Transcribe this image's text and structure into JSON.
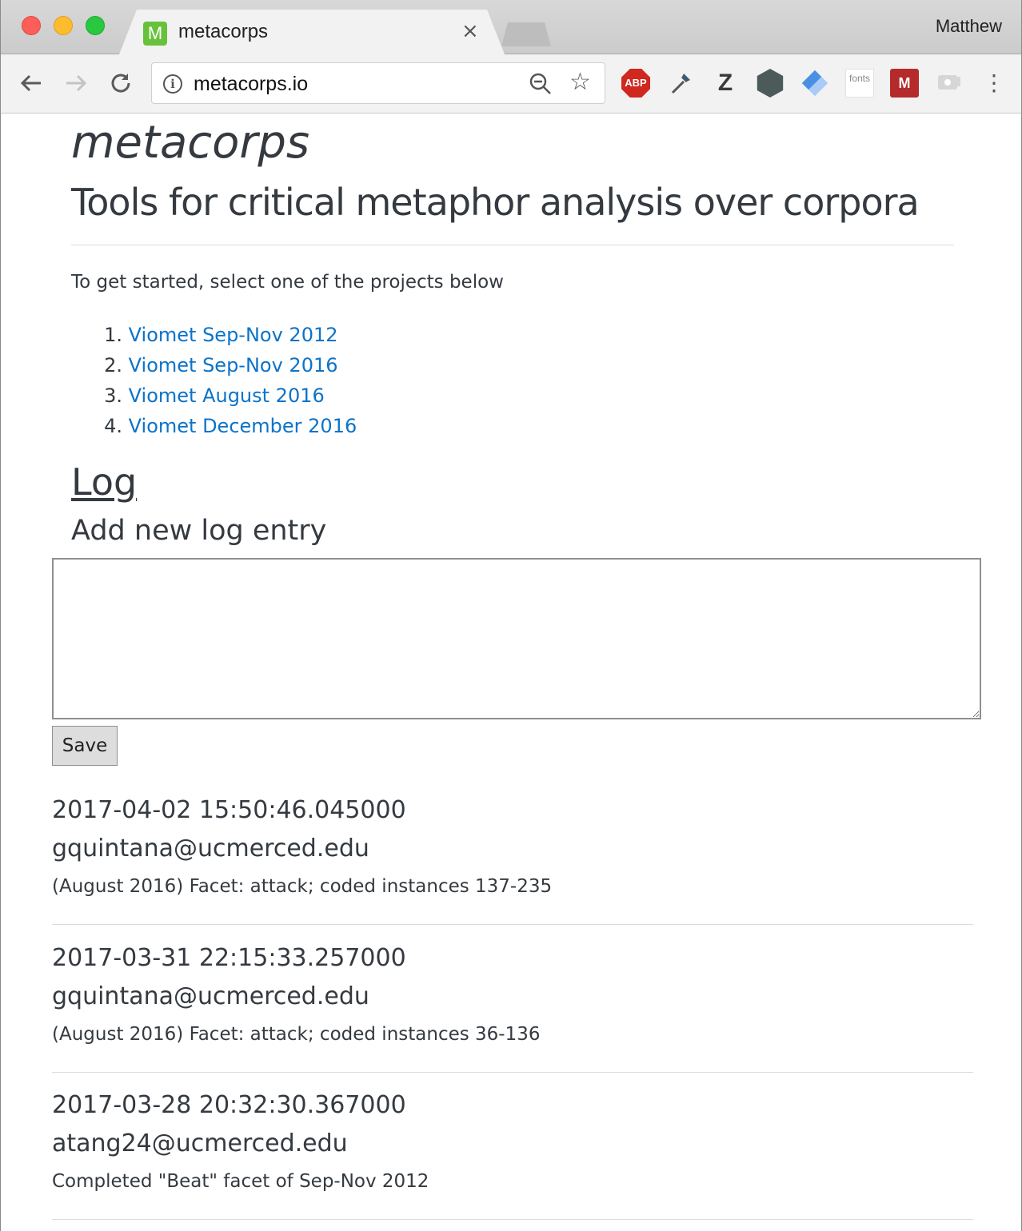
{
  "browser": {
    "profile_name": "Matthew",
    "tab": {
      "favicon_letter": "M",
      "title": "metacorps",
      "close_glyph": "×"
    },
    "url": "metacorps.io",
    "extensions": {
      "abp_label": "ABP",
      "z_label": "Z",
      "fonts_label": "fonts",
      "mendeley_label": "M"
    },
    "menu_glyph": "⋮"
  },
  "page": {
    "title": "metacorps",
    "subtitle": "Tools for critical metaphor analysis over corpora",
    "intro": "To get started, select one of the projects below",
    "projects": [
      {
        "num": "1.",
        "label": "Viomet Sep-Nov 2012"
      },
      {
        "num": "2.",
        "label": "Viomet Sep-Nov 2016"
      },
      {
        "num": "3.",
        "label": "Viomet August 2016"
      },
      {
        "num": "4.",
        "label": "Viomet December 2016"
      }
    ],
    "log_heading": "Log",
    "add_entry_heading": "Add new log entry",
    "textarea_value": "",
    "save_label": "Save",
    "entries": [
      {
        "timestamp": "2017-04-02 15:50:46.045000",
        "user": "gquintana@ucmerced.edu",
        "text": "(August 2016) Facet: attack; coded instances 137-235"
      },
      {
        "timestamp": "2017-03-31 22:15:33.257000",
        "user": "gquintana@ucmerced.edu",
        "text": "(August 2016) Facet: attack; coded instances 36-136"
      },
      {
        "timestamp": "2017-03-28 20:32:30.367000",
        "user": "atang24@ucmerced.edu",
        "text": "Completed \"Beat\" facet of Sep-Nov 2012"
      }
    ]
  },
  "colors": {
    "link": "#0b73c9",
    "text": "#343a40",
    "favicon_bg": "#67c23a",
    "abp_red": "#d0281f",
    "mendeley_red": "#b52b2b"
  }
}
